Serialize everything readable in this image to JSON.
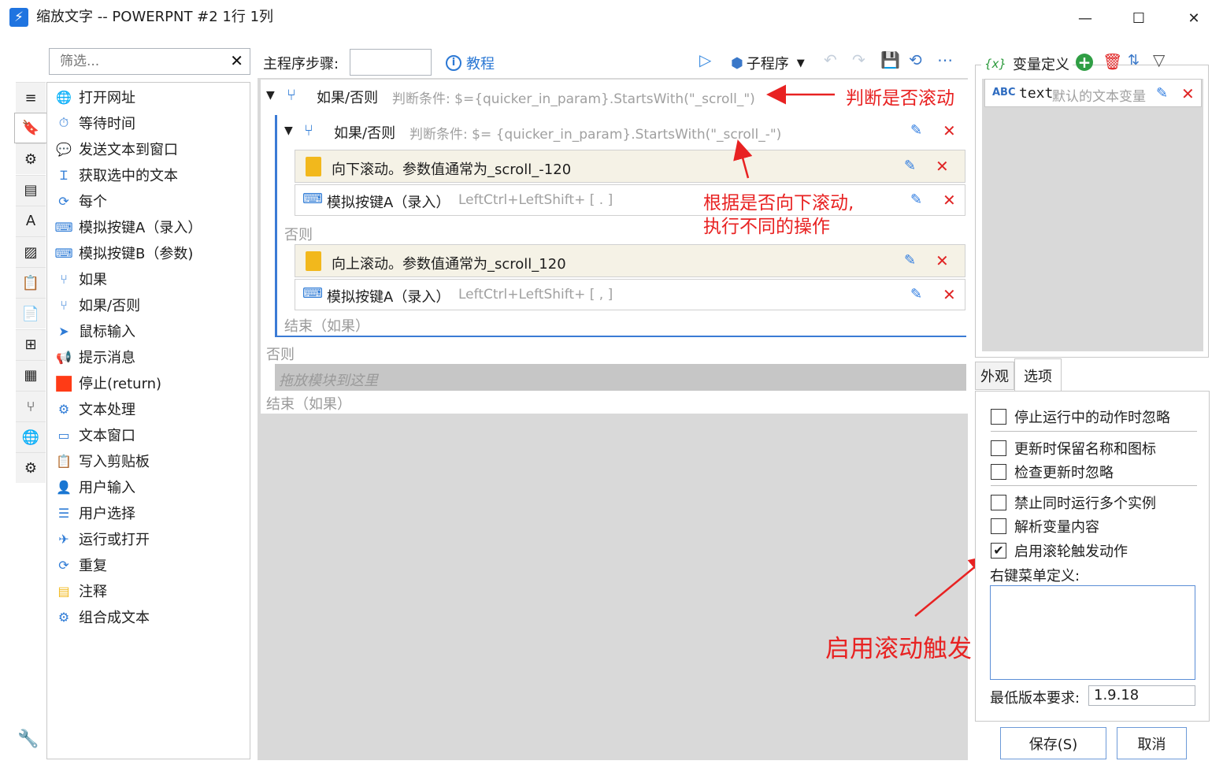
{
  "window": {
    "title": "缩放文字 -- POWERPNT #2 1行 1列",
    "minimize": "—",
    "maximize": "☐",
    "close": "✕"
  },
  "search": {
    "placeholder": "筛选...",
    "clear": "✕"
  },
  "actions": [
    {
      "label": "打开网址",
      "icon": "globe-icon",
      "glyph": "🌐"
    },
    {
      "label": "等待时间",
      "icon": "timer-icon",
      "glyph": "⏱"
    },
    {
      "label": "发送文本到窗口",
      "icon": "message-icon",
      "glyph": "💬"
    },
    {
      "label": "获取选中的文本",
      "icon": "text-cursor-icon",
      "glyph": "Ɪ"
    },
    {
      "label": "每个",
      "icon": "loop-icon",
      "glyph": "⟳"
    },
    {
      "label": "模拟按键A（录入）",
      "icon": "keyboard-icon",
      "glyph": "⌨"
    },
    {
      "label": "模拟按键B（参数)",
      "icon": "keyboard-icon",
      "glyph": "⌨"
    },
    {
      "label": "如果",
      "icon": "branch-icon",
      "glyph": "⑂"
    },
    {
      "label": "如果/否则",
      "icon": "branch-icon",
      "glyph": "⑂"
    },
    {
      "label": "鼠标输入",
      "icon": "cursor-icon",
      "glyph": "➤"
    },
    {
      "label": "提示消息",
      "icon": "megaphone-icon",
      "glyph": "📢"
    },
    {
      "label": "停止(return)",
      "icon": "stop-icon",
      "glyph": "■"
    },
    {
      "label": "文本处理",
      "icon": "gear-icon",
      "glyph": "⚙"
    },
    {
      "label": "文本窗口",
      "icon": "window-icon",
      "glyph": "▭"
    },
    {
      "label": "写入剪贴板",
      "icon": "clipboard-icon",
      "glyph": "📋"
    },
    {
      "label": "用户输入",
      "icon": "user-input-icon",
      "glyph": "👤"
    },
    {
      "label": "用户选择",
      "icon": "list-icon",
      "glyph": "☰"
    },
    {
      "label": "运行或打开",
      "icon": "paper-plane-icon",
      "glyph": "✈"
    },
    {
      "label": "重复",
      "icon": "repeat-icon",
      "glyph": "⟳"
    },
    {
      "label": "注释",
      "icon": "note-icon",
      "glyph": "▤"
    },
    {
      "label": "组合成文本",
      "icon": "gear-icon",
      "glyph": "⚙"
    }
  ],
  "left_tabs": [
    {
      "icon": "menu-icon",
      "glyph": "≡"
    },
    {
      "icon": "bookmark-icon",
      "glyph": "🔖"
    },
    {
      "icon": "settings-icon",
      "glyph": "⚙"
    },
    {
      "icon": "window-icon",
      "glyph": "▤"
    },
    {
      "icon": "font-icon",
      "glyph": "A"
    },
    {
      "icon": "image-icon",
      "glyph": "▨"
    },
    {
      "icon": "clipboard-icon",
      "glyph": "📋"
    },
    {
      "icon": "document-icon",
      "glyph": "📄"
    },
    {
      "icon": "windows-icon",
      "glyph": "⊞"
    },
    {
      "icon": "calculator-icon",
      "glyph": "▦"
    },
    {
      "icon": "git-branch-icon",
      "glyph": "⑂"
    },
    {
      "icon": "globe-icon",
      "glyph": "🌐"
    },
    {
      "icon": "gears-icon",
      "glyph": "⚙"
    }
  ],
  "toolbar": {
    "main_steps_label": "主程序步骤:",
    "tutorial": "教程",
    "sub_program": "子程序"
  },
  "editor": {
    "outer_title": "如果/否则",
    "outer_cond": "判断条件:  $={quicker_in_param}.StartsWith(\"_scroll_\")",
    "inner_title": "如果/否则",
    "inner_cond": "判断条件:  $= {quicker_in_param}.StartsWith(\"_scroll_-\")",
    "step1": "向下滚动。参数值通常为_scroll_-120",
    "step2_title": "模拟按键A（录入）",
    "step2_keys": "LeftCtrl+LeftShift+ [ . ]",
    "else_inner": "否则",
    "step3": "向上滚动。参数值通常为_scroll_120",
    "step4_title": "模拟按键A（录入）",
    "step4_keys": "LeftCtrl+LeftShift+ [ , ]",
    "end_inner": "结束（如果）",
    "else_outer": "否则",
    "drop_hint": "拖放模块到这里",
    "end_outer": "结束（如果）"
  },
  "annotations": {
    "a1": "判断是否滚动",
    "a2_line1": "根据是否向下滚动,",
    "a2_line2": "执行不同的操作",
    "a3": "启用滚动触发"
  },
  "variables": {
    "header": "变量定义",
    "header_icon": "{x}",
    "items": [
      {
        "type": "ABC",
        "name": "text",
        "desc": "默认的文本变量"
      }
    ]
  },
  "tabs": {
    "appearance": "外观",
    "options": "选项"
  },
  "options": [
    {
      "label": "停止运行中的动作时忽略",
      "checked": false
    },
    {
      "label": "更新时保留名称和图标",
      "checked": false
    },
    {
      "label": "检查更新时忽略",
      "checked": false
    },
    {
      "label": "禁止同时运行多个实例",
      "checked": false
    },
    {
      "label": "解析变量内容",
      "checked": false
    },
    {
      "label": "启用滚轮触发动作",
      "checked": true
    }
  ],
  "context_menu_label": "右键菜单定义:",
  "min_version_label": "最低版本要求:",
  "min_version_value": "1.9.18",
  "buttons": {
    "save": "保存(S)",
    "cancel": "取消"
  }
}
